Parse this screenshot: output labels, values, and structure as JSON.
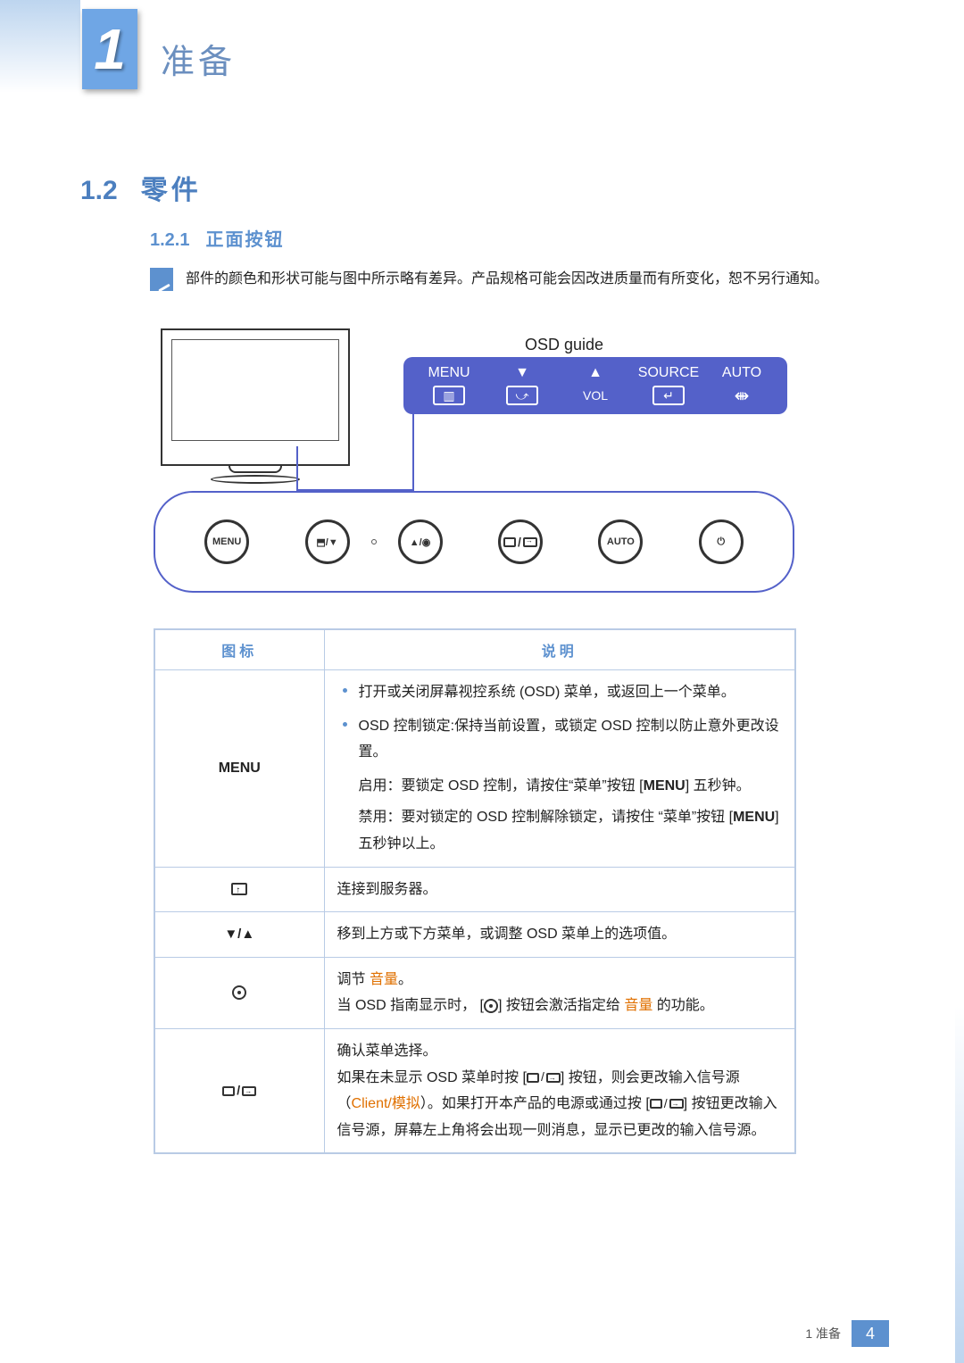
{
  "chapter": {
    "number": "1",
    "title": "准备"
  },
  "section": {
    "number": "1.2",
    "title": "零件"
  },
  "subsection": {
    "number": "1.2.1",
    "title": "正面按钮"
  },
  "note": "部件的颜色和形状可能与图中所示略有差异。产品规格可能会因改进质量而有所变化，恕不另行通知。",
  "diagram": {
    "osd_label": "OSD guide",
    "osd_items": [
      "MENU",
      "▼",
      "▲",
      "SOURCE",
      "AUTO"
    ],
    "osd_sub": [
      "",
      "",
      "VOL",
      "",
      ""
    ],
    "base_buttons": [
      "MENU",
      "▲/▼",
      "◉",
      "▲/◉",
      "⧉/↪",
      "AUTO",
      "⏻"
    ]
  },
  "table": {
    "headers": {
      "icon": "图标",
      "desc": "说明"
    },
    "rows": {
      "menu": {
        "icon": "MENU",
        "b1": "打开或关闭屏幕视控系统 (OSD) 菜单，或返回上一个菜单。",
        "b2": "OSD 控制锁定:保持当前设置，或锁定 OSD 控制以防止意外更改设置。",
        "p1_a": "启用：要锁定 OSD 控制，请按住“菜单”按钮 [",
        "p1_b": "MENU",
        "p1_c": "] 五秒钟。",
        "p2_a": "禁用：要对锁定的 OSD 控制解除锁定，请按住 “菜单”按钮 [",
        "p2_b": "MENU",
        "p2_c": "] 五秒钟以上。"
      },
      "connect": {
        "desc": "连接到服务器。"
      },
      "arrows": {
        "icon": "▼/▲",
        "desc": "移到上方或下方菜单，或调整 OSD 菜单上的选项值。"
      },
      "volume": {
        "line1_a": "调节 ",
        "line1_b": "音量",
        "line1_c": "。",
        "line2_a": "当 OSD 指南显示时， [",
        "line2_b": "] 按钮会激活指定给 ",
        "line2_c": "音量",
        "line2_d": " 的功能。"
      },
      "source": {
        "line1": "确认菜单选择。",
        "line2_a": "如果在未显示 OSD 菜单时按 [",
        "line2_b": "] 按钮，则会更改输入信号源（",
        "line2_c": "Client/模拟",
        "line2_d": "）。如果打开本产品的电源或通过按 [",
        "line2_e": "] 按钮更改输入信号源，屏幕左上角将会出现一则消息，显示已更改的输入信号源。"
      }
    }
  },
  "footer": {
    "label": "1 准备",
    "page": "4"
  }
}
